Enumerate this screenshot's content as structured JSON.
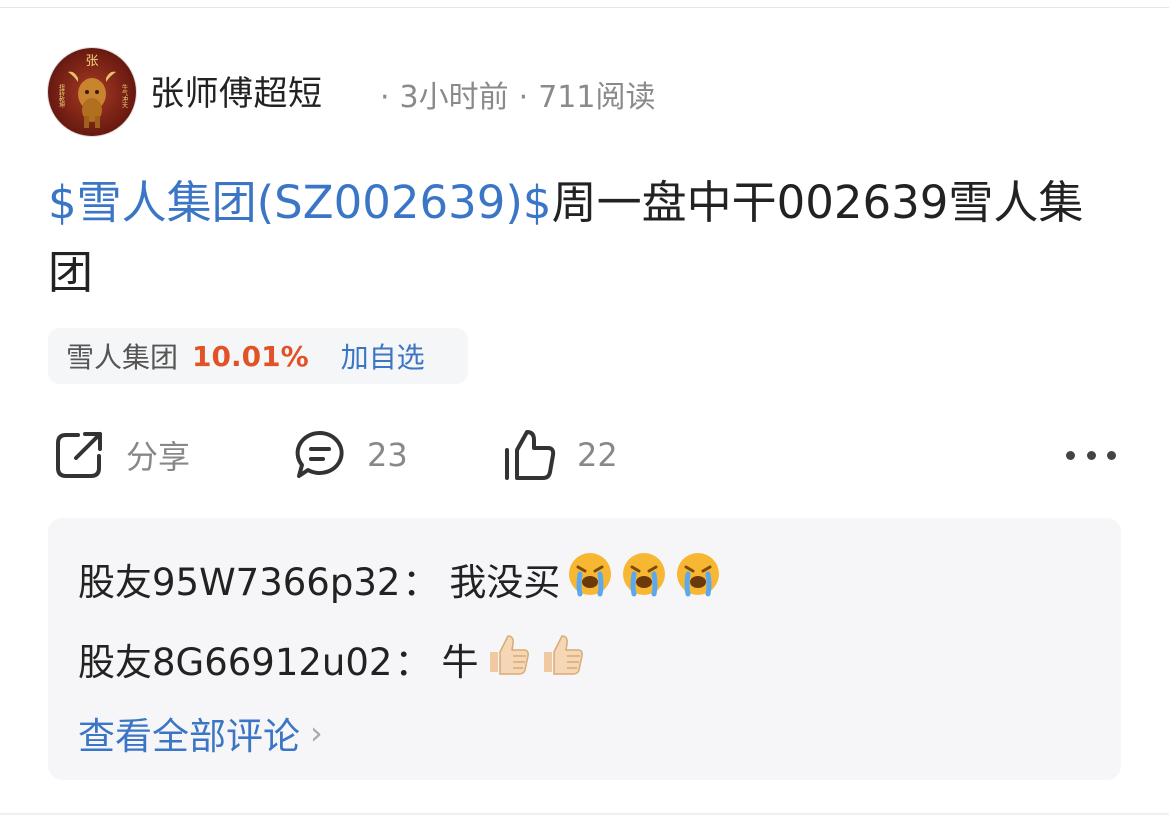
{
  "header": {
    "author": "张师傅超短",
    "time": "3小时前",
    "reads": "711阅读",
    "separator": "·",
    "avatar_text": {
      "top": "张",
      "left": "扭转乾坤",
      "right": "牛气冲天"
    }
  },
  "post": {
    "stock_link": "$雪人集团(SZ002639)$",
    "text": "周一盘中干002639雪人集团"
  },
  "stock_chip": {
    "name": "雪人集团",
    "change": "10.01%",
    "add_label": "加自选",
    "change_color": "#e15228"
  },
  "actions": {
    "share_label": "分享",
    "comment_count": "23",
    "like_count": "22",
    "share_icon": "share-icon",
    "comment_icon": "comment-icon",
    "like_icon": "thumbs-up-icon",
    "more_icon": "more-icon"
  },
  "comments": {
    "items": [
      {
        "user": "股友95W7366p32",
        "sep": "：",
        "text": "我没买",
        "emoji": [
          "crying-face",
          "crying-face",
          "crying-face"
        ]
      },
      {
        "user": "股友8G66912u02",
        "sep": "：",
        "text": "牛",
        "emoji": [
          "thumbs-up",
          "thumbs-up"
        ]
      }
    ],
    "view_all": "查看全部评论",
    "view_all_chevron": "›"
  },
  "colors": {
    "link_blue": "#3b76c6",
    "up_red": "#e15228"
  }
}
